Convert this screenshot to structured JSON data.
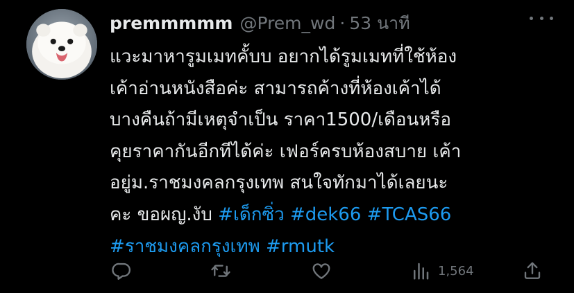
{
  "tweet": {
    "display_name": "premmmmm",
    "handle": "@Prem_wd",
    "separator": "·",
    "timestamp": "53 นาที",
    "lines": [
      {
        "segments": [
          {
            "text": "แวะมาหารูมเมทคั้บบ อยากได้รูมเมทที่ใช้ห้อง",
            "type": "text"
          }
        ]
      },
      {
        "segments": [
          {
            "text": "เค้าอ่านหนังสือค่ะ  สามารถค้างที่ห้องเค้าได้",
            "type": "text"
          }
        ]
      },
      {
        "segments": [
          {
            "text": "บางคืนถ้ามีเหตุจำเป็น ราคา1500/เดือนหรือ",
            "type": "text"
          }
        ]
      },
      {
        "segments": [
          {
            "text": "คุยราคากันอีกทีได้ค่ะ เฟอร์ครบห้องสบาย เค้า",
            "type": "text"
          }
        ]
      },
      {
        "segments": [
          {
            "text": "อยู่ม.ราชมงคลกรุงเทพ สนใจทักมาได้เลยนะ",
            "type": "text"
          }
        ]
      },
      {
        "segments": [
          {
            "text": "คะ ขอผญ.งับ ",
            "type": "text"
          },
          {
            "text": "#เด็กซิ่ว",
            "type": "hashtag"
          },
          {
            "text": " ",
            "type": "text"
          },
          {
            "text": "#dek66",
            "type": "hashtag"
          },
          {
            "text": " ",
            "type": "text"
          },
          {
            "text": "#TCAS66",
            "type": "hashtag"
          }
        ]
      },
      {
        "segments": [
          {
            "text": "#ราชมงคลกรุงเทพ",
            "type": "hashtag"
          },
          {
            "text": " ",
            "type": "text"
          },
          {
            "text": "#rmutk",
            "type": "hashtag"
          }
        ]
      }
    ]
  },
  "actions": {
    "reply": {
      "icon": "reply-icon",
      "count": ""
    },
    "retweet": {
      "icon": "retweet-icon",
      "count": ""
    },
    "like": {
      "icon": "heart-icon",
      "count": ""
    },
    "views": {
      "icon": "views-icon",
      "count": "1,564"
    },
    "share": {
      "icon": "share-icon"
    }
  },
  "colors": {
    "background": "#000000",
    "text": "#e7e9ea",
    "muted": "#71767b",
    "hashtag": "#1d9bf0"
  }
}
